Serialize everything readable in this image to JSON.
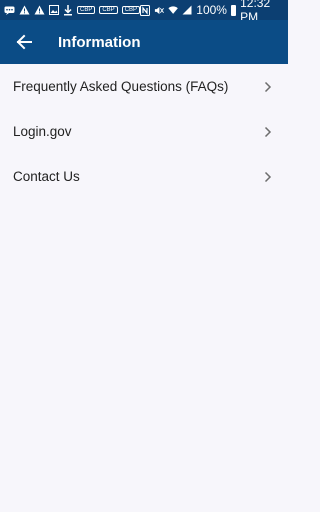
{
  "status_bar": {
    "left_icons": [
      "message-icon",
      "warning-icon",
      "warning-icon",
      "image-icon",
      "download-icon",
      "cbp-icon",
      "cbp-icon",
      "cbp-icon"
    ],
    "left_badges": [
      "CBP",
      "CBP",
      "CBP"
    ],
    "right_icons": [
      "nfc-icon",
      "mute-icon",
      "wifi-icon",
      "signal-icon"
    ],
    "battery_text": "100%",
    "time": "12:32 PM"
  },
  "app_bar": {
    "title": "Information",
    "background": "#0b4c86"
  },
  "menu": {
    "items": [
      {
        "label": "Frequently Asked Questions (FAQs)"
      },
      {
        "label": "Login.gov"
      },
      {
        "label": "Contact Us"
      }
    ]
  }
}
